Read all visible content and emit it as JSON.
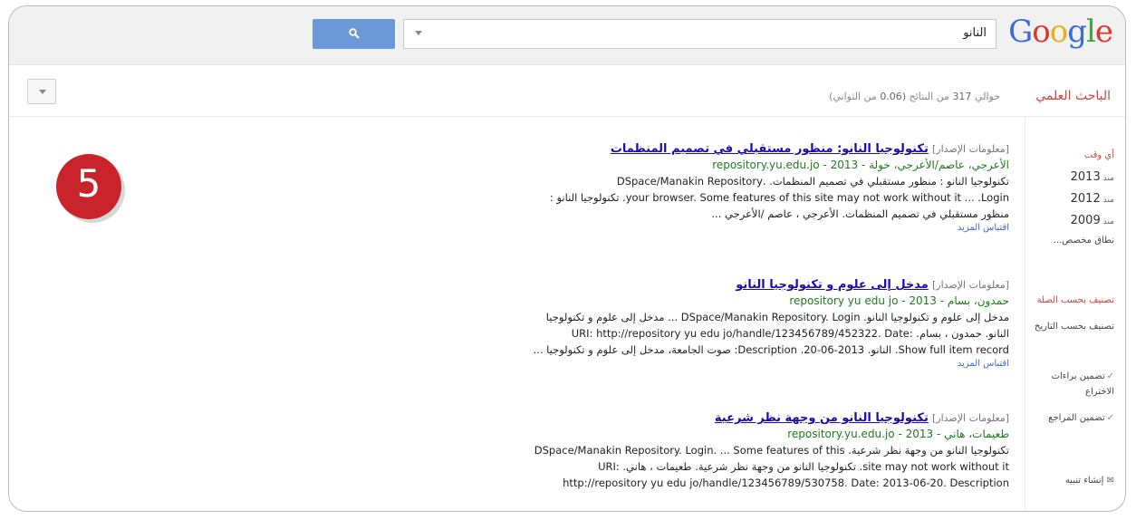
{
  "header": {
    "logo": "Google",
    "search": {
      "value": "النانو"
    }
  },
  "subbar": {
    "scholar_label": "الباحث العلمي",
    "stats_prefix": "حوالي",
    "stats_count": "317",
    "stats_mid": "من النتائج",
    "stats_time": "(0.06",
    "stats_suffix": "من الثواني)"
  },
  "sidebar": {
    "any_time": "أي وقت",
    "since_label": "منذ",
    "years": [
      "2013",
      "2012",
      "2009"
    ],
    "custom_range": "نطاق مخصص...",
    "sort_relevance": "تصنيف بحسب الصلة",
    "sort_date": "تصنيف بحسب التاريخ",
    "include_patents": "تضمين براءات الاختراع",
    "include_citations": "تضمين المراجع",
    "create_alert": "إنشاء تنبيه"
  },
  "results": [
    {
      "tag": "[معلومات الإصدار]",
      "title": "تكنولوجيا النانو: منظور مستقبلي في تصميم المنظمات",
      "url": "الأعرجي، عاصم/الأعرجي، خولة - 2013 - repository.yu.edu.jo",
      "snippet": [
        "تكنولوجيا النانو : منظور مستقبلي في تصميم المنظمات. .DSpace/Manakin Repository",
        "your browser. Some features of this site may not work without it ... .Login. تكنولوجيا النانو :",
        "منظور مستقبلي في تصميم المنظمات. الأعرجي ، عاصم /الأعرجي ..."
      ],
      "links": "اقتباس  المزيد"
    },
    {
      "tag": "[معلومات الإصدار]",
      "title": "مدخل إلى علوم و تكنولوجيا النانو",
      "url": "حمدون، بسام - 2013 - repository yu edu jo",
      "snippet": [
        "مدخل إلى علوم و تكنولوجيا النانو. DSpace/Manakin Repository. Login ... مدخل إلى علوم و تكنولوجيا",
        "النانو. حمدون ، بسام. :URI: http://repository yu edu jo/handle/123456789/452322. Date",
        "Show full item record. النانو. 2013-06-20. Description: صوت الجامعة، مدخل إلى علوم و تكنولوجيا ..."
      ],
      "links": "اقتباس  المزيد"
    },
    {
      "tag": "[معلومات الإصدار]",
      "title": "تكنولوجيا النانو من وجهة نظر شرعية",
      "url": "طعيمات، هاني - 2013 - repository.yu.edu.jo",
      "snippet": [
        "تكنولوجيا النانو من وجهة نظر شرعية. DSpace/Manakin Repository. Login. ... Some features of this",
        "site may not work without it. تكنولوجيا النانو من وجهة نظر شرعية. طعيمات ، هاني. :URI",
        "http://repository yu edu jo/handle/123456789/530758. Date: 2013-06-20. Description"
      ],
      "links": ""
    }
  ],
  "badge": {
    "number": "5"
  },
  "colors": {
    "accent": "#c9232b",
    "link": "#1a0dab",
    "url": "#1f7a1f",
    "scholar": "#d2433a",
    "button": "#6b98d7"
  }
}
